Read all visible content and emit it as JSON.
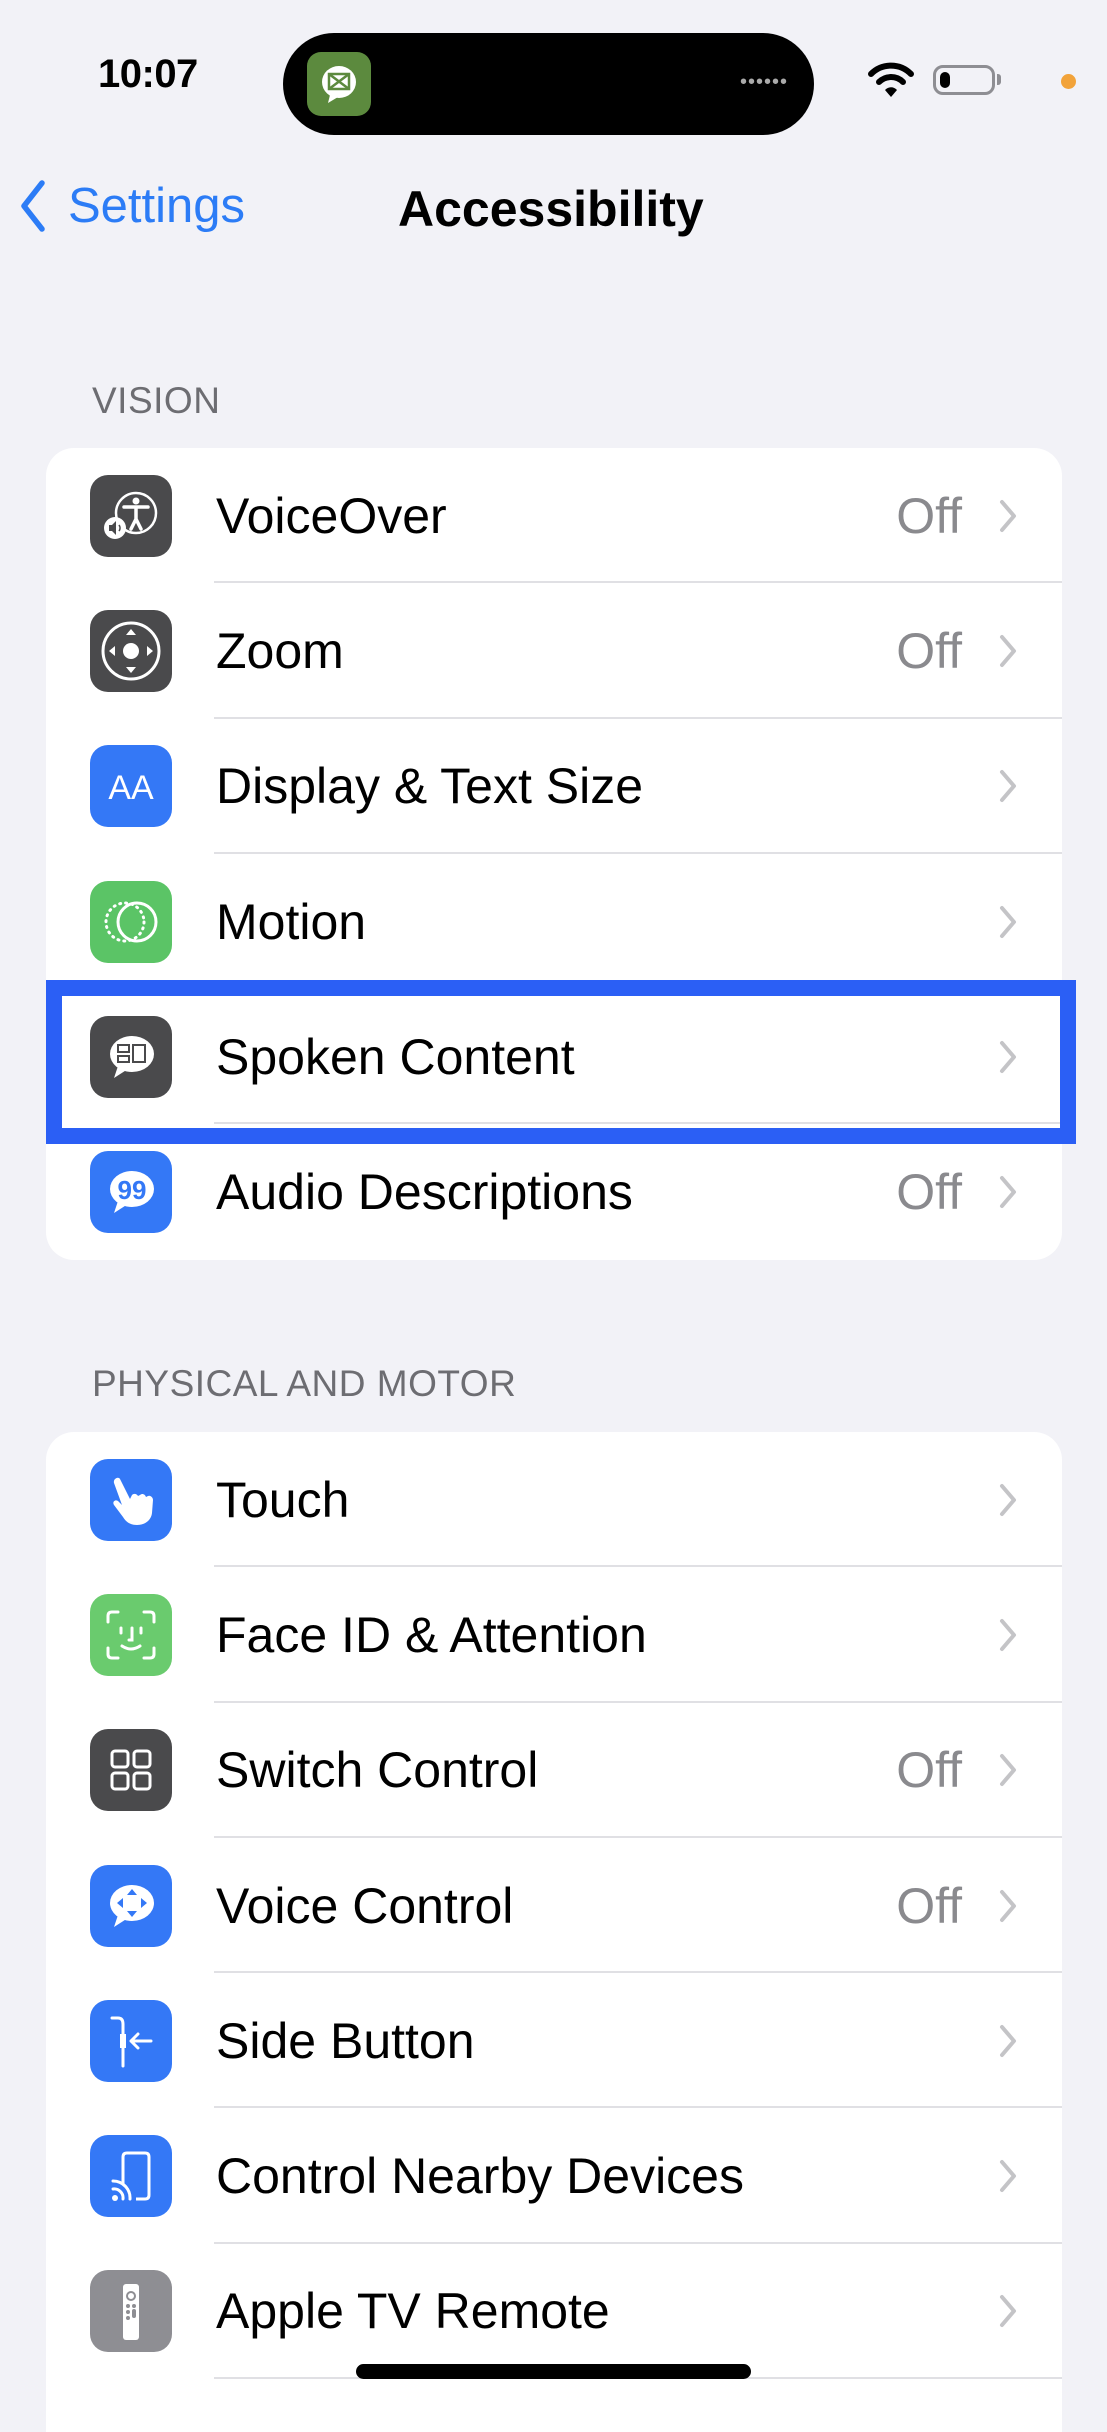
{
  "status_bar": {
    "time": "10:07",
    "island_app_icon": "mail-message-icon",
    "battery_level_percent": 20,
    "privacy_indicator_color": "#F2A33A"
  },
  "nav": {
    "back_label": "Settings",
    "title": "Accessibility"
  },
  "sections": [
    {
      "header": "VISION",
      "items": [
        {
          "label": "VoiceOver",
          "value": "Off",
          "icon": "voiceover-icon",
          "icon_bg": "#4A4A4C"
        },
        {
          "label": "Zoom",
          "value": "Off",
          "icon": "zoom-icon",
          "icon_bg": "#4A4A4C"
        },
        {
          "label": "Display & Text Size",
          "value": "",
          "icon": "text-size-icon",
          "icon_bg": "#3478F6"
        },
        {
          "label": "Motion",
          "value": "",
          "icon": "motion-icon",
          "icon_bg": "#5BC466"
        },
        {
          "label": "Spoken Content",
          "value": "",
          "icon": "spoken-content-icon",
          "icon_bg": "#4A4A4C",
          "highlighted": true
        },
        {
          "label": "Audio Descriptions",
          "value": "Off",
          "icon": "audio-descriptions-icon",
          "icon_bg": "#3478F6"
        }
      ]
    },
    {
      "header": "PHYSICAL AND MOTOR",
      "items": [
        {
          "label": "Touch",
          "value": "",
          "icon": "touch-hand-icon",
          "icon_bg": "#3478F6"
        },
        {
          "label": "Face ID & Attention",
          "value": "",
          "icon": "face-id-icon",
          "icon_bg": "#6ACB6E"
        },
        {
          "label": "Switch Control",
          "value": "Off",
          "icon": "switch-control-icon",
          "icon_bg": "#4A4A4C"
        },
        {
          "label": "Voice Control",
          "value": "Off",
          "icon": "voice-control-icon",
          "icon_bg": "#3478F6"
        },
        {
          "label": "Side Button",
          "value": "",
          "icon": "side-button-icon",
          "icon_bg": "#3478F6"
        },
        {
          "label": "Control Nearby Devices",
          "value": "",
          "icon": "nearby-devices-icon",
          "icon_bg": "#3478F6"
        },
        {
          "label": "Apple TV Remote",
          "value": "",
          "icon": "tv-remote-icon",
          "icon_bg": "#8E8E93"
        }
      ]
    }
  ],
  "colors": {
    "accent": "#2C7CF6",
    "highlight_box": "#2B5FF5",
    "background": "#F2F2F7"
  }
}
